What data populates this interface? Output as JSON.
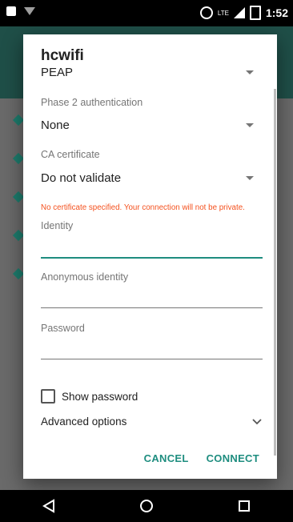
{
  "statusbar": {
    "time": "1:52",
    "lte_label": "LTE",
    "icons": [
      "image-icon",
      "wifi-question-icon",
      "alarm-icon",
      "signal-icon",
      "battery-icon"
    ]
  },
  "dialog": {
    "title": "hcwifi",
    "eap_method": "PEAP",
    "phase2": {
      "label": "Phase 2 authentication",
      "value": "None"
    },
    "ca_cert": {
      "label": "CA certificate",
      "value": "Do not validate"
    },
    "warning": "No certificate specified. Your connection will not be private.",
    "identity": {
      "label": "Identity",
      "value": ""
    },
    "anonymous_identity": {
      "label": "Anonymous identity",
      "value": ""
    },
    "password": {
      "label": "Password",
      "value": ""
    },
    "show_password": {
      "label": "Show password",
      "checked": false
    },
    "advanced_options": "Advanced options",
    "cancel": "CANCEL",
    "connect": "CONNECT"
  },
  "colors": {
    "accent": "#1e8d7f",
    "warning": "#f4511e",
    "appbar": "#1f4f48"
  }
}
